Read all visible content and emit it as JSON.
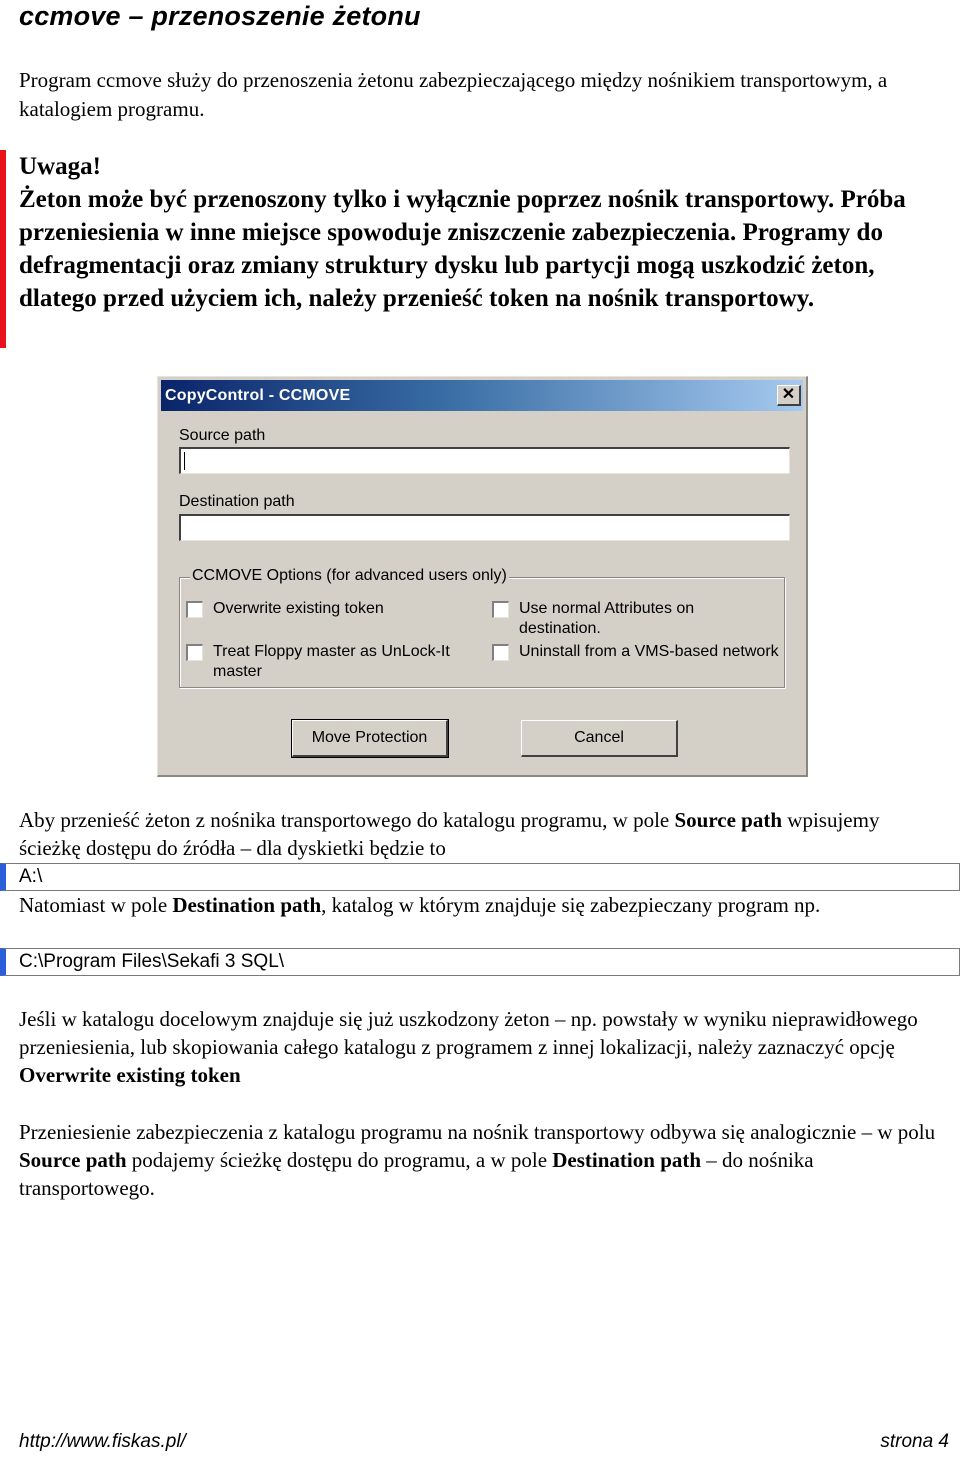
{
  "document": {
    "title": "ccmove – przenoszenie żetonu",
    "intro": "Program ccmove służy do przenoszenia żetonu zabezpieczającego między nośnikiem transportowym, a katalogiem programu.",
    "warning": {
      "heading": "Uwaga!",
      "body": "Żeton może być przenoszony tylko i wyłącznie poprzez nośnik transportowy. Próba przeniesienia w inne miejsce spowoduje zniszczenie zabezpieczenia. Programy do defragmentacji oraz zmiany struktury dysku lub partycji mogą uszkodzić żeton, dlatego przed użyciem ich, należy przenieść token na nośnik transportowy.",
      "accent_color": "#e8121b"
    }
  },
  "dialog": {
    "title": "CopyControl - CCMOVE",
    "close_label": "✕",
    "source_label": "Source path",
    "source_value": "",
    "destination_label": "Destination path",
    "destination_value": "",
    "options_legend": "CCMOVE Options (for advanced users only)",
    "options": [
      {
        "label": "Overwrite existing token",
        "checked": false
      },
      {
        "label": "Use normal Attributes on destination.",
        "checked": false
      },
      {
        "label": "Treat Floppy master as UnLock-It master",
        "checked": false
      },
      {
        "label": "Uninstall from a VMS-based network",
        "checked": false
      }
    ],
    "move_button": "Move Protection",
    "cancel_button": "Cancel"
  },
  "instructions": {
    "p1_pre": "Aby przenieść żeton z nośnika transportowego do katalogu programu, w pole ",
    "p1_bold": "Source path",
    "p1_post": " wpisujemy ścieżkę dostępu do źródła – dla dyskietki będzie to",
    "code1": "A:\\",
    "p2_pre": "Natomiast w pole ",
    "p2_bold": "Destination path",
    "p2_post": ", katalog w którym znajduje się zabezpieczany program np.",
    "code2": "C:\\Program Files\\Sekafi 3 SQL\\",
    "p3_pre": "Jeśli w katalogu docelowym znajduje się już uszkodzony żeton – np. powstały w wyniku nieprawidłowego przeniesienia, lub skopiowania całego katalogu z programem z innej lokalizacji, należy zaznaczyć opcję ",
    "p3_bold": "Overwrite existing token",
    "p4_pre": "Przeniesienie zabezpieczenia z katalogu programu na nośnik transportowy odbywa się analogicznie – w polu ",
    "p4_bold1": "Source path",
    "p4_mid": " podajemy ścieżkę dostępu do programu, a w pole ",
    "p4_bold2": "Destination path",
    "p4_post": " – do nośnika transportowego.",
    "code_accent_color": "#2b5fd9"
  },
  "footer": {
    "url": "http://www.fiskas.pl/",
    "page": "strona 4"
  }
}
